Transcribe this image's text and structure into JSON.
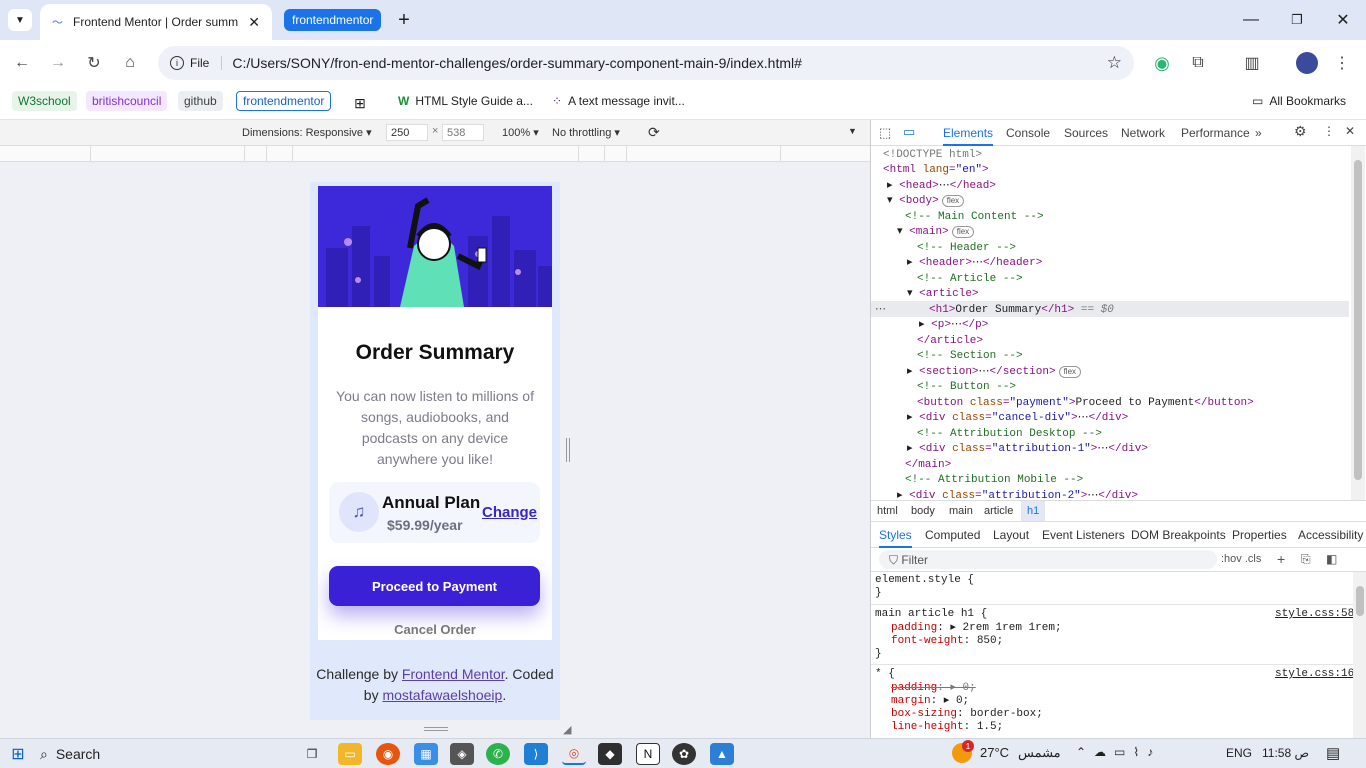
{
  "browser": {
    "tab_title": "Frontend Mentor | Order summ",
    "tab_group": "frontendmentor",
    "site_chip": "File",
    "url": "C:/Users/SONY/fron-end-mentor-challenges/order-summary-component-main-9/index.html#",
    "bookmarks": [
      "W3school",
      "britishcouncil",
      "github",
      "frontendmentor",
      "HTML Style Guide a...",
      "A text message invit...",
      "All Bookmarks"
    ]
  },
  "device_toolbar": {
    "dimensions_label": "Dimensions: Responsive",
    "width": "250",
    "height": "538",
    "zoom": "100%",
    "throttle": "No throttling"
  },
  "page": {
    "title": "Order Summary",
    "description": "You can now listen to millions of songs, audiobooks, and podcasts on any device anywhere you like!",
    "plan_name": "Annual Plan",
    "plan_price": "$59.99/year",
    "change_link": "Change",
    "pay_button": "Proceed to Payment",
    "cancel": "Cancel Order",
    "attribution_prefix": "Challenge by",
    "attribution_link1": "Frontend Mentor",
    "attribution_mid": ". Coded by",
    "attribution_link2": "mostafawaelshoeip",
    "attribution_end": "."
  },
  "devtools": {
    "tabs": [
      "Elements",
      "Console",
      "Sources",
      "Network",
      "Performance"
    ],
    "breadcrumbs": [
      "html",
      "body",
      "main",
      "article",
      "h1"
    ],
    "style_tabs": [
      "Styles",
      "Computed",
      "Layout",
      "Event Listeners",
      "DOM Breakpoints",
      "Properties",
      "Accessibility"
    ],
    "filter_placeholder": "Filter",
    "filter_tools": ":hov .cls",
    "dom": {
      "doctype": "<!DOCTYPE html>",
      "c_main": "<!-- Main Content -->",
      "c_header": "<!-- Header -->",
      "c_article": "<!-- Article  -->",
      "h1_text": "Order Summary",
      "h1_eq": "== $0",
      "c_section": "<!-- Section -->",
      "c_button": "<!-- Button  -->",
      "button_text": "Proceed to Payment",
      "c_attr_desktop": "<!-- Attribution Desktop -->",
      "c_attr_mobile": "<!-- Attribution Mobile -->",
      "badge": "flex"
    },
    "styles": {
      "element_style": "element.style {",
      "rule1_selector": "main article h1 {",
      "rule1_source": "style.css:58",
      "rule1_padding": "2rem 1rem 1rem;",
      "rule1_weight": "850;",
      "rule2_source": "style.css:16",
      "rule2_padding": "0;",
      "rule2_margin": "0;",
      "rule2_box": "border-box;",
      "rule2_lh": "1.5;"
    }
  },
  "taskbar": {
    "search": "Search",
    "temperature": "27°C",
    "weather_label": "مشمس",
    "lang": "ENG",
    "time": "11:58 ص",
    "notif_count": "1"
  }
}
